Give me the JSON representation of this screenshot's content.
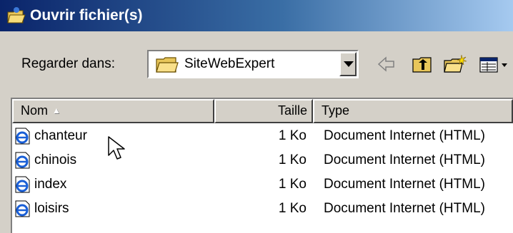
{
  "window": {
    "title": "Ouvrir fichier(s)"
  },
  "look_in": {
    "label": "Regarder dans:",
    "folder": "SiteWebExpert"
  },
  "toolbar": {
    "icons": [
      "back-arrow-icon",
      "up-folder-icon",
      "new-folder-icon",
      "view-menu-icon"
    ]
  },
  "columns": {
    "name": "Nom",
    "size": "Taille",
    "type": "Type"
  },
  "files": [
    {
      "name": "chanteur",
      "size": "1 Ko",
      "type": "Document Internet (HTML)"
    },
    {
      "name": "chinois",
      "size": "1 Ko",
      "type": "Document Internet (HTML)"
    },
    {
      "name": "index",
      "size": "1 Ko",
      "type": "Document Internet (HTML)"
    },
    {
      "name": "loisirs",
      "size": "1 Ko",
      "type": "Document Internet (HTML)"
    }
  ],
  "colors": {
    "title_start": "#0a246a",
    "title_end": "#a6caf0",
    "face": "#d4d0c8"
  }
}
